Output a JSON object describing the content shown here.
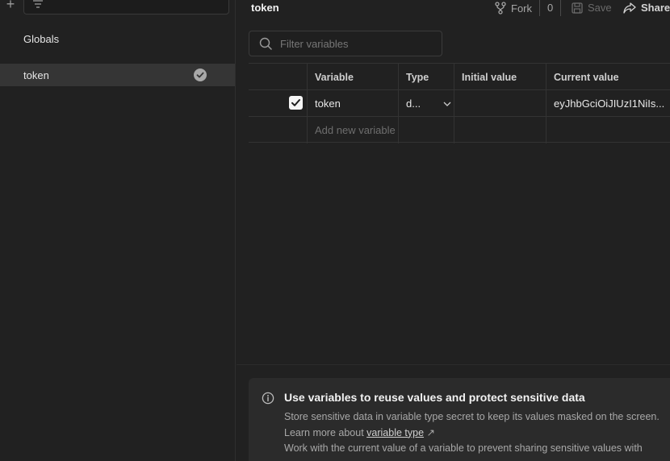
{
  "sidebar": {
    "items": [
      {
        "label": "Globals"
      },
      {
        "label": "token",
        "active": true
      }
    ]
  },
  "header": {
    "title": "token",
    "fork_label": "Fork",
    "fork_count": "0",
    "save_label": "Save",
    "share_label": "Share"
  },
  "search": {
    "placeholder": "Filter variables"
  },
  "table": {
    "columns": [
      "Variable",
      "Type",
      "Initial value",
      "Current value"
    ],
    "rows": [
      {
        "enabled": true,
        "variable": "token",
        "type": "d...",
        "initial_value": "",
        "current_value": "eyJhbGciOiJIUzI1NiIs..."
      }
    ],
    "add_placeholder": "Add new variable"
  },
  "info": {
    "title": "Use variables to reuse values and protect sensitive data",
    "line1_a": "Store sensitive data in variable type secret to keep its values masked on the screen. Learn more about ",
    "line1_link": "variable type",
    "line1_arrow": "↗",
    "line2": "Work with the current value of a variable to prevent sharing sensitive values with"
  },
  "colors": {
    "background": "#212121",
    "active_item": "#353535",
    "info_panel": "#2b2b2b"
  }
}
